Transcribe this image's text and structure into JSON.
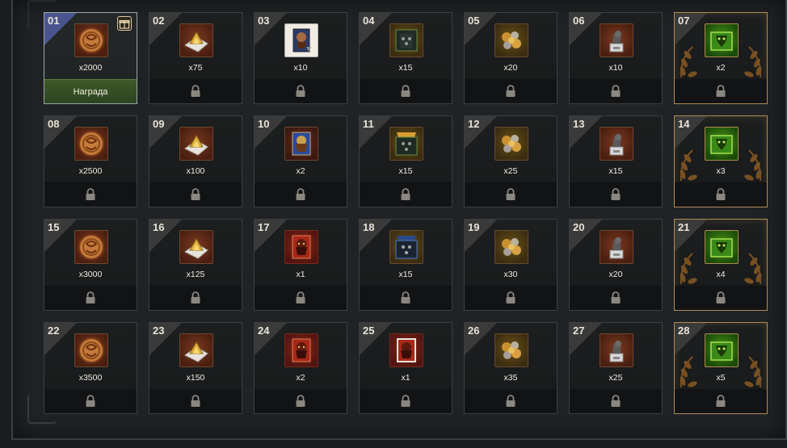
{
  "claim_label": "Награда",
  "colors": {
    "special_border": "#b08a52",
    "claim_green": "#3e5a2a",
    "claimable_corner": "#4a5590"
  },
  "cells": [
    {
      "num": "01",
      "qty": "x2000",
      "item": "coin",
      "state": "claimable",
      "icon_name": "gift-icon"
    },
    {
      "num": "02",
      "qty": "x75",
      "item": "gold-pile",
      "state": "locked"
    },
    {
      "num": "03",
      "qty": "x10",
      "item": "card-white",
      "state": "locked"
    },
    {
      "num": "04",
      "qty": "x15",
      "item": "armor-dark",
      "state": "locked"
    },
    {
      "num": "05",
      "qty": "x20",
      "item": "ore",
      "state": "locked"
    },
    {
      "num": "06",
      "qty": "x10",
      "item": "statue",
      "state": "locked"
    },
    {
      "num": "07",
      "qty": "x2",
      "item": "green-chest",
      "state": "locked",
      "special": true
    },
    {
      "num": "08",
      "qty": "x2500",
      "item": "coin",
      "state": "locked"
    },
    {
      "num": "09",
      "qty": "x100",
      "item": "gold-pile",
      "state": "locked"
    },
    {
      "num": "10",
      "qty": "x2",
      "item": "card-blue",
      "state": "locked"
    },
    {
      "num": "11",
      "qty": "x15",
      "item": "armor-gold",
      "state": "locked"
    },
    {
      "num": "12",
      "qty": "x25",
      "item": "ore",
      "state": "locked"
    },
    {
      "num": "13",
      "qty": "x15",
      "item": "statue",
      "state": "locked"
    },
    {
      "num": "14",
      "qty": "x3",
      "item": "green-chest",
      "state": "locked",
      "special": true
    },
    {
      "num": "15",
      "qty": "x3000",
      "item": "coin",
      "state": "locked"
    },
    {
      "num": "16",
      "qty": "x125",
      "item": "gold-pile",
      "state": "locked"
    },
    {
      "num": "17",
      "qty": "x1",
      "item": "card-red",
      "state": "locked"
    },
    {
      "num": "18",
      "qty": "x15",
      "item": "armor-blue",
      "state": "locked"
    },
    {
      "num": "19",
      "qty": "x30",
      "item": "ore",
      "state": "locked"
    },
    {
      "num": "20",
      "qty": "x20",
      "item": "statue",
      "state": "locked"
    },
    {
      "num": "21",
      "qty": "x4",
      "item": "green-chest",
      "state": "locked",
      "special": true
    },
    {
      "num": "22",
      "qty": "x3500",
      "item": "coin",
      "state": "locked"
    },
    {
      "num": "23",
      "qty": "x150",
      "item": "gold-pile",
      "state": "locked"
    },
    {
      "num": "24",
      "qty": "x2",
      "item": "card-red",
      "state": "locked"
    },
    {
      "num": "25",
      "qty": "x1",
      "item": "card-red-frame",
      "state": "locked"
    },
    {
      "num": "26",
      "qty": "x35",
      "item": "ore",
      "state": "locked"
    },
    {
      "num": "27",
      "qty": "x25",
      "item": "statue",
      "state": "locked"
    },
    {
      "num": "28",
      "qty": "x5",
      "item": "green-chest",
      "state": "locked",
      "special": true
    }
  ]
}
